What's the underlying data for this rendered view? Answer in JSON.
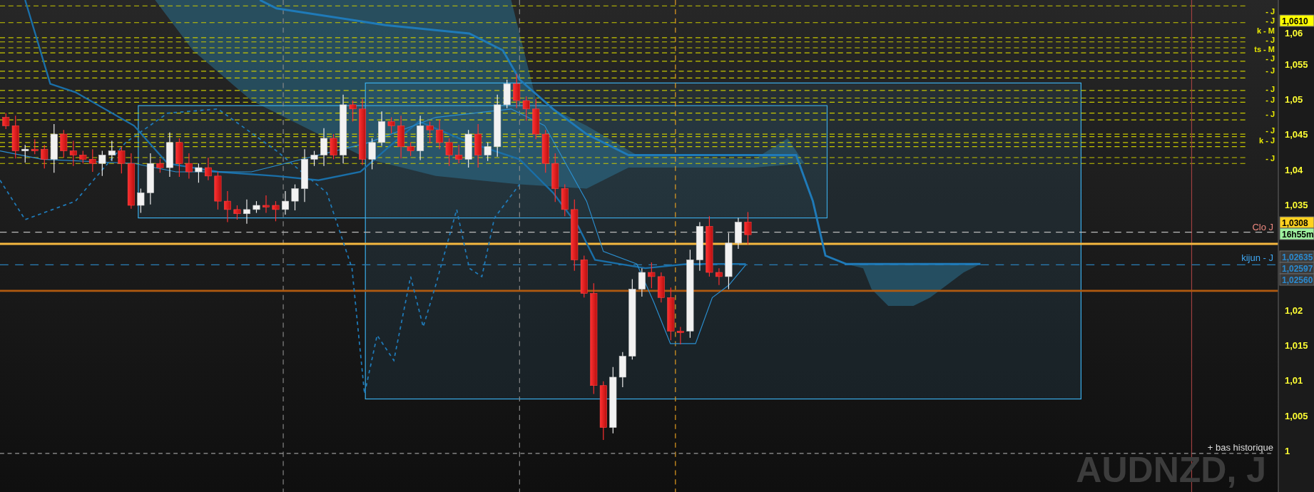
{
  "chart": {
    "watermark": "AUDNZD, J",
    "y_axis_labels": [
      "1,06",
      "1,055",
      "1,05",
      "1,045",
      "1,04",
      "1,035",
      "1,02",
      "1,015",
      "1,01",
      "1,005",
      "1"
    ],
    "price_tags": [
      {
        "text": "1,0610",
        "kind": "level"
      },
      {
        "text": "1,0308",
        "kind": "last"
      },
      {
        "text": "16h55m",
        "kind": "timer"
      },
      {
        "text": "1,02635",
        "kind": "indicator"
      },
      {
        "text": "1,02597",
        "kind": "indicator"
      },
      {
        "text": "1,02560",
        "kind": "indicator"
      }
    ],
    "line_labels": [
      "- J",
      "- J",
      "k - M",
      "- J",
      "ts - M",
      "- J",
      "- J",
      "- J",
      "- J",
      "- J",
      "- J",
      "k - J",
      "- J"
    ],
    "annotations": [
      {
        "text": "Clo J",
        "kind": "close"
      },
      {
        "text": "kijun - J",
        "kind": "kijun"
      },
      {
        "text": "+ bas historique",
        "kind": "note"
      }
    ]
  }
}
